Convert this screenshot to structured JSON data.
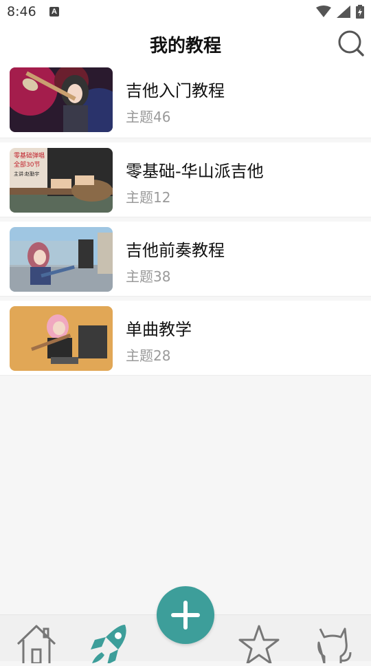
{
  "status": {
    "time": "8:46",
    "badge": "A"
  },
  "header": {
    "title": "我的教程"
  },
  "courses": [
    {
      "title": "吉他入门教程",
      "subtitle": "主题46",
      "thumb_colors": [
        "#d8205a",
        "#2a3a7a",
        "#6a1f2e"
      ]
    },
    {
      "title": "零基础-华山派吉他",
      "subtitle": "主题12",
      "thumb_colors": [
        "#c9b8a4",
        "#2b2b2b",
        "#7a5a40"
      ],
      "thumb_text": [
        "零基础弹唱",
        "全部30节",
        "主讲:赵勤宇"
      ]
    },
    {
      "title": "吉他前奏教程",
      "subtitle": "主题38",
      "thumb_colors": [
        "#7fb4d6",
        "#3a4a7a",
        "#9aa4ad"
      ]
    },
    {
      "title": "单曲教学",
      "subtitle": "主题28",
      "thumb_colors": [
        "#e8b060",
        "#f0a8c0",
        "#3a3a3a"
      ]
    }
  ],
  "colors": {
    "accent": "#3d9e9a",
    "background": "#f6f6f6"
  },
  "tabbar": {
    "items": [
      "home-icon",
      "rocket-icon",
      "add-icon",
      "star-icon",
      "cat-icon"
    ]
  }
}
